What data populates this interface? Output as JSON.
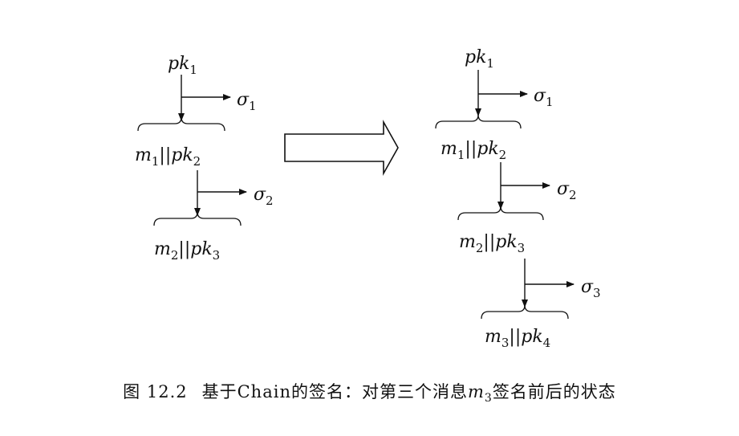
{
  "figure": {
    "before": {
      "pk": {
        "base": "pk",
        "sub": "1"
      },
      "steps": [
        {
          "sigma": {
            "base": "σ",
            "sub": "1"
          },
          "label": {
            "m": "m",
            "msub": "1",
            "sep": "||",
            "pk": "pk",
            "pksub": "2"
          }
        },
        {
          "sigma": {
            "base": "σ",
            "sub": "2"
          },
          "label": {
            "m": "m",
            "msub": "2",
            "sep": "||",
            "pk": "pk",
            "pksub": "3"
          }
        }
      ]
    },
    "after": {
      "pk": {
        "base": "pk",
        "sub": "1"
      },
      "steps": [
        {
          "sigma": {
            "base": "σ",
            "sub": "1"
          },
          "label": {
            "m": "m",
            "msub": "1",
            "sep": "||",
            "pk": "pk",
            "pksub": "2"
          }
        },
        {
          "sigma": {
            "base": "σ",
            "sub": "2"
          },
          "label": {
            "m": "m",
            "msub": "2",
            "sep": "||",
            "pk": "pk",
            "pksub": "3"
          }
        },
        {
          "sigma": {
            "base": "σ",
            "sub": "3"
          },
          "label": {
            "m": "m",
            "msub": "3",
            "sep": "||",
            "pk": "pk",
            "pksub": "4"
          }
        }
      ]
    }
  },
  "caption": {
    "number": "图 12.2",
    "text_before": "基于Chain的签名：对第三个消息",
    "var": "m",
    "var_sub": "3",
    "text_after": "签名前后的状态"
  }
}
